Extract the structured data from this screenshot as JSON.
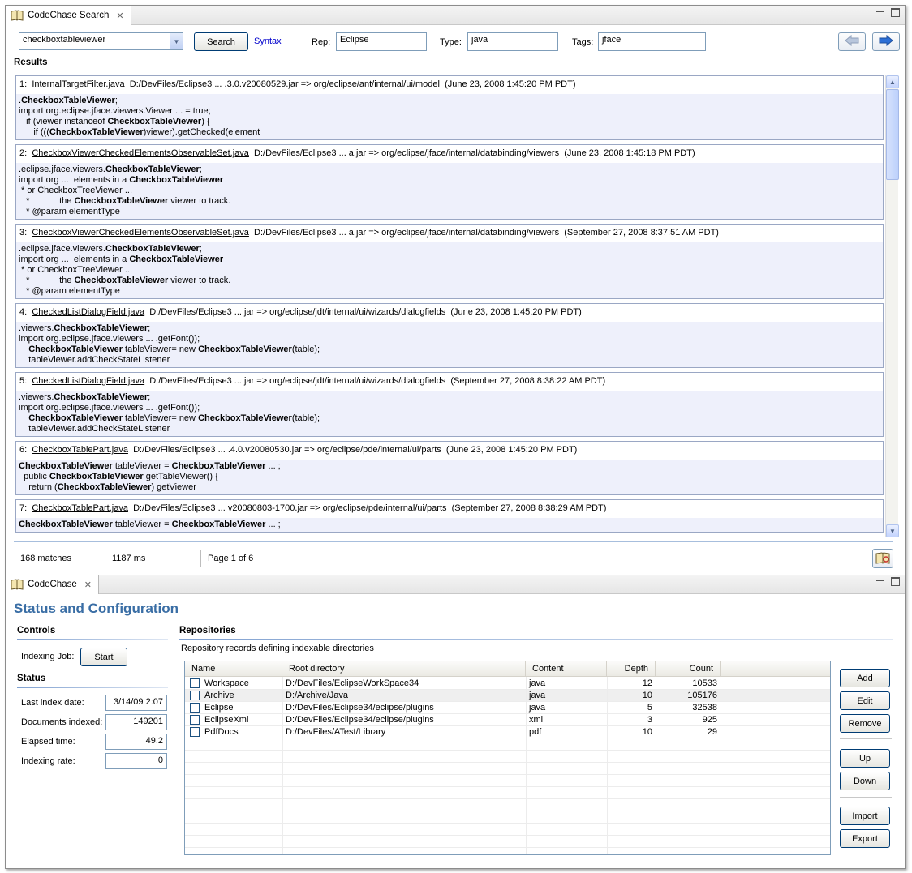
{
  "top_view": {
    "tab_title": "CodeChase Search",
    "search": {
      "query": "checkboxtableviewer",
      "search_label": "Search",
      "syntax_label": "Syntax",
      "rep_label": "Rep:",
      "rep_value": "Eclipse",
      "type_label": "Type:",
      "type_value": "java",
      "tags_label": "Tags:",
      "tags_value": "jface"
    },
    "results_label": "Results",
    "results": [
      {
        "index": "1:",
        "file": "InternalTargetFilter.java",
        "path": "D:/DevFiles/Eclipse3 ... .3.0.v20080529.jar => org/eclipse/ant/internal/ui/model",
        "date": "(June 23, 2008 1:45:20 PM PDT)",
        "lines": [
          [
            {
              "t": "."
            },
            {
              "t": "CheckboxTableViewer",
              "b": true
            },
            {
              "t": ";"
            }
          ],
          [
            {
              "t": "import org.eclipse.jface.viewers.Viewer ... = true;"
            }
          ],
          [
            {
              "t": "   if (viewer instanceof "
            },
            {
              "t": "CheckboxTableViewer",
              "b": true
            },
            {
              "t": ") {"
            }
          ],
          [
            {
              "t": "      if ((("
            },
            {
              "t": "CheckboxTableViewer",
              "b": true
            },
            {
              "t": ")viewer).getChecked(element"
            }
          ]
        ]
      },
      {
        "index": "2:",
        "file": "CheckboxViewerCheckedElementsObservableSet.java",
        "path": "D:/DevFiles/Eclipse3 ... a.jar => org/eclipse/jface/internal/databinding/viewers",
        "date": "(June 23, 2008 1:45:18 PM PDT)",
        "lines": [
          [
            {
              "t": ".eclipse.jface.viewers."
            },
            {
              "t": "CheckboxTableViewer",
              "b": true
            },
            {
              "t": ";"
            }
          ],
          [
            {
              "t": "import org ...  elements in a "
            },
            {
              "t": "CheckboxTableViewer",
              "b": true
            }
          ],
          [
            {
              "t": " * or CheckboxTreeViewer ..."
            }
          ],
          [
            {
              "t": "   *            the "
            },
            {
              "t": "CheckboxTableViewer",
              "b": true
            },
            {
              "t": " viewer to track."
            }
          ],
          [
            {
              "t": "   * @param elementType"
            }
          ]
        ]
      },
      {
        "index": "3:",
        "file": "CheckboxViewerCheckedElementsObservableSet.java",
        "path": "D:/DevFiles/Eclipse3 ... a.jar => org/eclipse/jface/internal/databinding/viewers",
        "date": "(September 27, 2008 8:37:51 AM PDT)",
        "lines": [
          [
            {
              "t": ".eclipse.jface.viewers."
            },
            {
              "t": "CheckboxTableViewer",
              "b": true
            },
            {
              "t": ";"
            }
          ],
          [
            {
              "t": "import org ...  elements in a "
            },
            {
              "t": "CheckboxTableViewer",
              "b": true
            }
          ],
          [
            {
              "t": " * or CheckboxTreeViewer ..."
            }
          ],
          [
            {
              "t": "   *            the "
            },
            {
              "t": "CheckboxTableViewer",
              "b": true
            },
            {
              "t": " viewer to track."
            }
          ],
          [
            {
              "t": "   * @param elementType"
            }
          ]
        ]
      },
      {
        "index": "4:",
        "file": "CheckedListDialogField.java",
        "path": "D:/DevFiles/Eclipse3 ... jar => org/eclipse/jdt/internal/ui/wizards/dialogfields",
        "date": "(June 23, 2008 1:45:20 PM PDT)",
        "lines": [
          [
            {
              "t": ".viewers."
            },
            {
              "t": "CheckboxTableViewer",
              "b": true
            },
            {
              "t": ";"
            }
          ],
          [
            {
              "t": "import org.eclipse.jface.viewers ... .getFont());"
            }
          ],
          [
            {
              "t": "    "
            },
            {
              "t": "CheckboxTableViewer",
              "b": true
            },
            {
              "t": " tableViewer= new "
            },
            {
              "t": "CheckboxTableViewer",
              "b": true
            },
            {
              "t": "(table);"
            }
          ],
          [
            {
              "t": "    tableViewer.addCheckStateListener"
            }
          ]
        ]
      },
      {
        "index": "5:",
        "file": "CheckedListDialogField.java",
        "path": "D:/DevFiles/Eclipse3 ... jar => org/eclipse/jdt/internal/ui/wizards/dialogfields",
        "date": "(September 27, 2008 8:38:22 AM PDT)",
        "lines": [
          [
            {
              "t": ".viewers."
            },
            {
              "t": "CheckboxTableViewer",
              "b": true
            },
            {
              "t": ";"
            }
          ],
          [
            {
              "t": "import org.eclipse.jface.viewers ... .getFont());"
            }
          ],
          [
            {
              "t": "    "
            },
            {
              "t": "CheckboxTableViewer",
              "b": true
            },
            {
              "t": " tableViewer= new "
            },
            {
              "t": "CheckboxTableViewer",
              "b": true
            },
            {
              "t": "(table);"
            }
          ],
          [
            {
              "t": "    tableViewer.addCheckStateListener"
            }
          ]
        ]
      },
      {
        "index": "6:",
        "file": "CheckboxTablePart.java",
        "path": "D:/DevFiles/Eclipse3 ... .4.0.v20080530.jar => org/eclipse/pde/internal/ui/parts",
        "date": "(June 23, 2008 1:45:20 PM PDT)",
        "lines": [
          [
            {
              "t": "CheckboxTableViewer",
              "b": true
            },
            {
              "t": " tableViewer = "
            },
            {
              "t": "CheckboxTableViewer",
              "b": true
            },
            {
              "t": " ... ;"
            }
          ],
          [
            {
              "t": "  public "
            },
            {
              "t": "CheckboxTableViewer",
              "b": true
            },
            {
              "t": " getTableViewer() {"
            }
          ],
          [
            {
              "t": "    return ("
            },
            {
              "t": "CheckboxTableViewer",
              "b": true
            },
            {
              "t": ") getViewer"
            }
          ]
        ]
      },
      {
        "index": "7:",
        "file": "CheckboxTablePart.java",
        "path": "D:/DevFiles/Eclipse3 ... v20080803-1700.jar => org/eclipse/pde/internal/ui/parts",
        "date": "(September 27, 2008 8:38:29 AM PDT)",
        "lines": [
          [
            {
              "t": "CheckboxTableViewer",
              "b": true
            },
            {
              "t": " tableViewer = "
            },
            {
              "t": "CheckboxTableViewer",
              "b": true
            },
            {
              "t": " ... ;"
            }
          ]
        ]
      }
    ],
    "status": {
      "matches": "168 matches",
      "time": "1187 ms",
      "page": "Page 1 of 6"
    }
  },
  "bottom_view": {
    "tab_title": "CodeChase",
    "title": "Status and Configuration",
    "controls": {
      "heading": "Controls",
      "indexing_job_label": "Indexing Job:",
      "start_label": "Start"
    },
    "status": {
      "heading": "Status",
      "fields": [
        {
          "label": "Last index date:",
          "value": "3/14/09 2:07"
        },
        {
          "label": "Documents indexed:",
          "value": "149201"
        },
        {
          "label": "Elapsed time:",
          "value": "49.2"
        },
        {
          "label": "Indexing rate:",
          "value": "0"
        }
      ]
    },
    "repositories": {
      "heading": "Repositories",
      "description": "Repository records defining indexable directories",
      "columns": [
        "Name",
        "Root directory",
        "Content",
        "Depth",
        "Count"
      ],
      "rows": [
        {
          "name": "Workspace",
          "root": "D:/DevFiles/EclipseWorkSpace34",
          "content": "java",
          "depth": "12",
          "count": "10533",
          "checked": false
        },
        {
          "name": "Archive",
          "root": "D:/Archive/Java",
          "content": "java",
          "depth": "10",
          "count": "105176",
          "checked": false
        },
        {
          "name": "Eclipse",
          "root": "D:/DevFiles/Eclipse34/eclipse/plugins",
          "content": "java",
          "depth": "5",
          "count": "32538",
          "checked": false
        },
        {
          "name": "EclipseXml",
          "root": "D:/DevFiles/Eclipse34/eclipse/plugins",
          "content": "xml",
          "depth": "3",
          "count": "925",
          "checked": false
        },
        {
          "name": "PdfDocs",
          "root": "D:/DevFiles/ATest/Library",
          "content": "pdf",
          "depth": "10",
          "count": "29",
          "checked": false
        }
      ],
      "buttons": {
        "add": "Add",
        "edit": "Edit",
        "remove": "Remove",
        "up": "Up",
        "down": "Down",
        "import": "Import",
        "export": "Export"
      }
    }
  },
  "colors": {
    "accent": "#3a6ea5",
    "snippet_bg": "#eef0fb",
    "link": "#0000cc"
  }
}
